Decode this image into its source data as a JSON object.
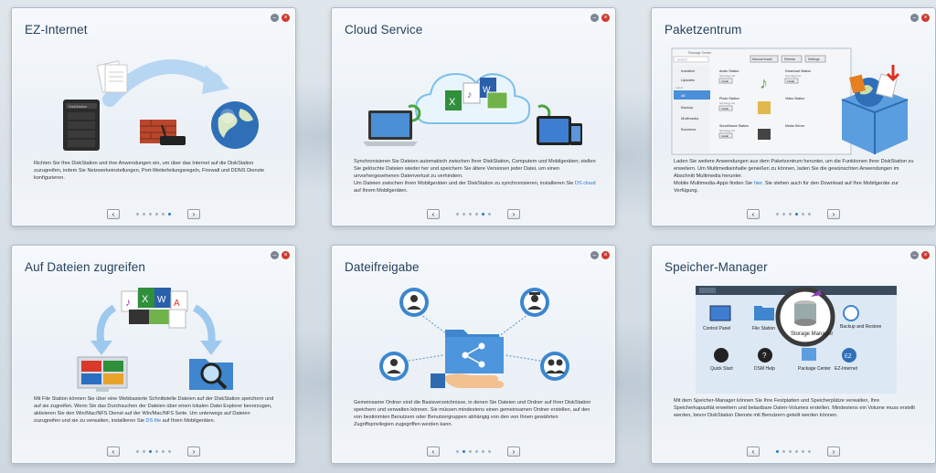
{
  "cards": [
    {
      "title": "EZ-Internet",
      "description": "Richten Sie Ihre DiskStation und ihre Anwendungen ein, um über das Internet auf die DiskStation zuzugreifen, indem Sie Netzwerkeinstellungen, Port-Weiterleitungsregeln, Firewall und DDNS Dienste konfigurieren.",
      "nav": {
        "prev": "‹",
        "next": "›"
      }
    },
    {
      "title": "Cloud Service",
      "description": "Synchronisieren Sie Dateien automatisch zwischen Ihrer DiskStation, Computern und Mobilgeräten; stellen Sie gelöschte Dateien wieder her und speichern Sie ältere Versionen jeder Datei, um einen unvorhergesehenen Datenverlust zu verhindern.",
      "description2": "Um Dateien zwischen Ihren Mobilgeräten und der DiskStation zu synchronisieren, installieren Sie",
      "link": "DS cloud",
      "description3": "auf Ihrem Mobilgeräten.",
      "nav": {
        "prev": "‹",
        "next": "›"
      }
    },
    {
      "title": "Paketzentrum",
      "description": "Laden Sie weitere Anwendungen aus dem Paketzentrum herunter, um die Funktionen Ihrer DiskStation zu erweitern. Um Multimediainhalte genießen zu können, laden Sie die gewünschten Anwendungen im Abschnitt Multimedia herunter.",
      "description2": "Mobile Multimedia-Apps finden Sie",
      "link": "hier",
      "description3": ". Sie stehen auch für den Download auf Ihre Mobilgeräte zur Verfügung.",
      "package_center": {
        "window_title": "Package Center",
        "search": "Search",
        "buttons": [
          "Manual Install",
          "Refresh",
          "Settings"
        ],
        "sidebar": [
          "Installed",
          "Updates",
          "Latest",
          "All",
          "Backup",
          "Multimedia",
          "Business"
        ],
        "apps": [
          "Audio Station",
          "Download Station",
          "Photo Station",
          "Video Station",
          "Surveillance Station",
          "Media Server"
        ],
        "publisher": "Synology Inc.",
        "install_label": "Install"
      },
      "nav": {
        "prev": "‹",
        "next": "›"
      }
    },
    {
      "title": "Auf Dateien zugreifen",
      "description": "Mit File Station können Sie über eine Webbasierte Schnittstelle Dateien auf der DiskStation speichern und auf sie zugreifen. Wenn Sie das Durchsuchen der Dateien über einen lokalen Datei Explorer bevorzugen, aktivieren Sie den Win/Mac/NFS Dienst auf der Win/Mac/NFS Seite. Um unterwegs auf Dateien zuzugreifen und sie zu verwalten, installieren Sie",
      "link": "DS file",
      "description3": "auf Ihren Mobilgeräten.",
      "nav": {
        "prev": "‹",
        "next": "›"
      }
    },
    {
      "title": "Dateifreigabe",
      "description": "Gemeinsame Ordner sind die Basisverzeichnisse, in denen Sie Dateien und Ordner auf Ihrer DiskStation speichern und verwalten können. Sie müssen mindestens einen gemeinsamen Ordner erstellen, auf den von bestimmten Benutzern oder Benutzergruppen abhängig von den von Ihnen gewährten Zugriffsprivilegien zugegriffen werden kann.",
      "nav": {
        "prev": "‹",
        "next": "›"
      }
    },
    {
      "title": "Speicher-Manager",
      "description": "Mit dem Speicher-Manager können Sie Ihre Festplatten und Speicherplätze verwalten, Ihre Speicherkapazität erweitern und belastbare Daten-Volumes erstellen. Mindestens ein Volume muss erstellt werden, bevor DiskStation Dienste mit Benutzern geteilt werden können.",
      "desktop": {
        "icons": [
          "Control Panel",
          "File Station",
          "Storage Manager",
          "Backup and Restore",
          "Quick Start",
          "DSM Help",
          "Package Center",
          "EZ-Internet"
        ]
      },
      "nav": {
        "prev": "‹",
        "next": "›"
      }
    }
  ],
  "device_label": "DiskStation",
  "colors": {
    "accent": "#2b78c5",
    "title": "#25415c",
    "close": "#d1392b"
  }
}
